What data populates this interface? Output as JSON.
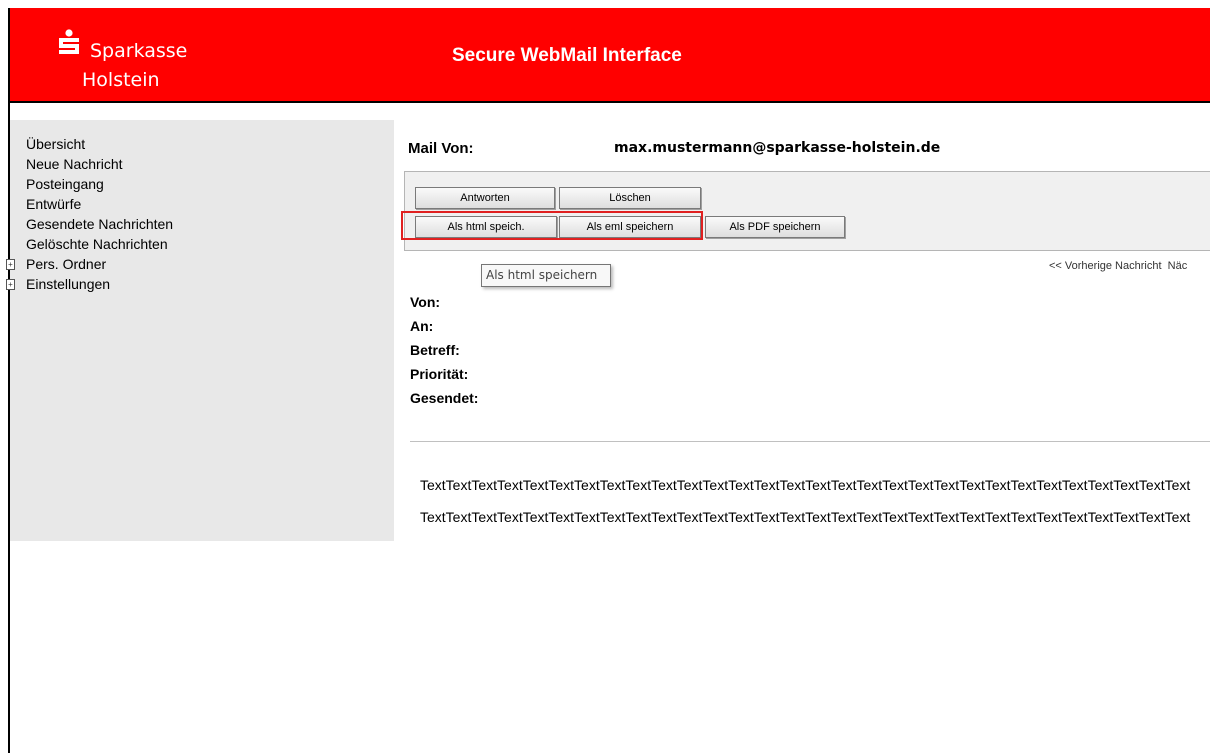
{
  "header": {
    "brand_line1": "Sparkasse",
    "brand_line2": "Holstein",
    "title": "Secure WebMail Interface",
    "brand_color": "#ff0000"
  },
  "sidebar": {
    "items": [
      {
        "label": "Übersicht",
        "expandable": false
      },
      {
        "label": "Neue Nachricht",
        "expandable": false
      },
      {
        "label": "Posteingang",
        "expandable": false
      },
      {
        "label": "Entwürfe",
        "expandable": false
      },
      {
        "label": "Gesendete Nachrichten",
        "expandable": false
      },
      {
        "label": "Gelöschte Nachrichten",
        "expandable": false
      },
      {
        "label": "Pers. Ordner",
        "expandable": true
      },
      {
        "label": "Einstellungen",
        "expandable": true
      }
    ]
  },
  "mail": {
    "from_label": "Mail Von:",
    "from_address": "max.mustermann@sparkasse-holstein.de"
  },
  "toolbar": {
    "reply": "Antworten",
    "delete": "Löschen",
    "save_html": "Als html speich.",
    "save_eml": "Als eml speichern",
    "save_pdf": "Als PDF speichern"
  },
  "tooltip": "Als html speichern",
  "message_nav": {
    "previous": "<< Vorherige Nachricht",
    "next": "Näc"
  },
  "fields": {
    "from": "Von:",
    "to": "An:",
    "subject": "Betreff:",
    "priority": "Priorität:",
    "sent": "Gesendet:"
  },
  "body": {
    "line1": "TextTextTextTextTextTextTextTextTextTextTextTextTextTextTextTextTextTextTextTextTextTextTextTextTextTextTextTextTextText",
    "line2": "TextTextTextTextTextTextTextTextTextTextTextTextTextTextTextTextTextTextTextTextTextTextTextTextTextTextTextTextTextText"
  }
}
